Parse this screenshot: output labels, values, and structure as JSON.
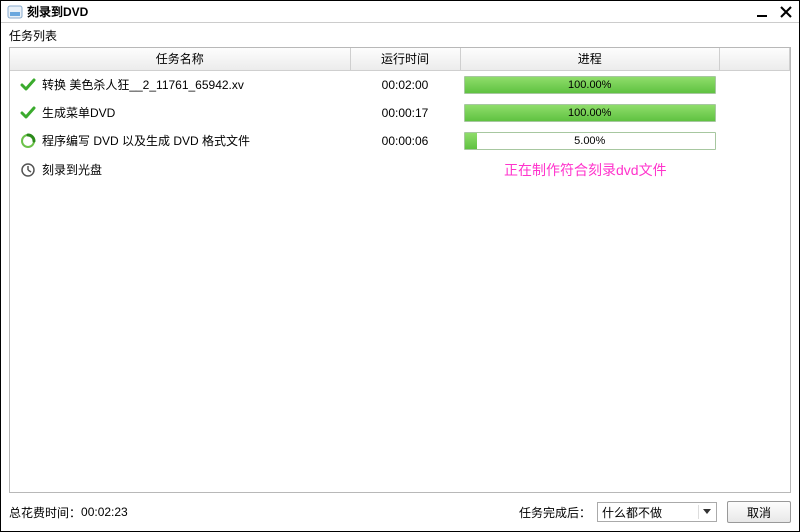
{
  "window": {
    "title": "刻录到DVD"
  },
  "task_list_label": "任务列表",
  "columns": {
    "name": "任务名称",
    "runtime": "运行时间",
    "progress": "进程",
    "last": ""
  },
  "tasks": [
    {
      "icon": "check",
      "name": "转换 美色杀人狂__2_11761_65942.xv",
      "runtime": "00:02:00",
      "progress_pct": 100,
      "progress_label": "100.00%"
    },
    {
      "icon": "check",
      "name": "生成菜单DVD",
      "runtime": "00:00:17",
      "progress_pct": 100,
      "progress_label": "100.00%"
    },
    {
      "icon": "spinner",
      "name": "程序编写 DVD 以及生成 DVD 格式文件",
      "runtime": "00:00:06",
      "progress_pct": 5,
      "progress_label": "5.00%"
    },
    {
      "icon": "clock",
      "name": "刻录到光盘",
      "runtime": "",
      "progress_pct": null,
      "progress_label": ""
    }
  ],
  "status_message": "正在制作符合刻录dvd文件",
  "footer": {
    "total_time_label": "总花费时间：",
    "total_time_value": "00:02:23",
    "after_complete_label": "任务完成后：",
    "after_complete_value": "什么都不做",
    "cancel_label": "取消"
  }
}
